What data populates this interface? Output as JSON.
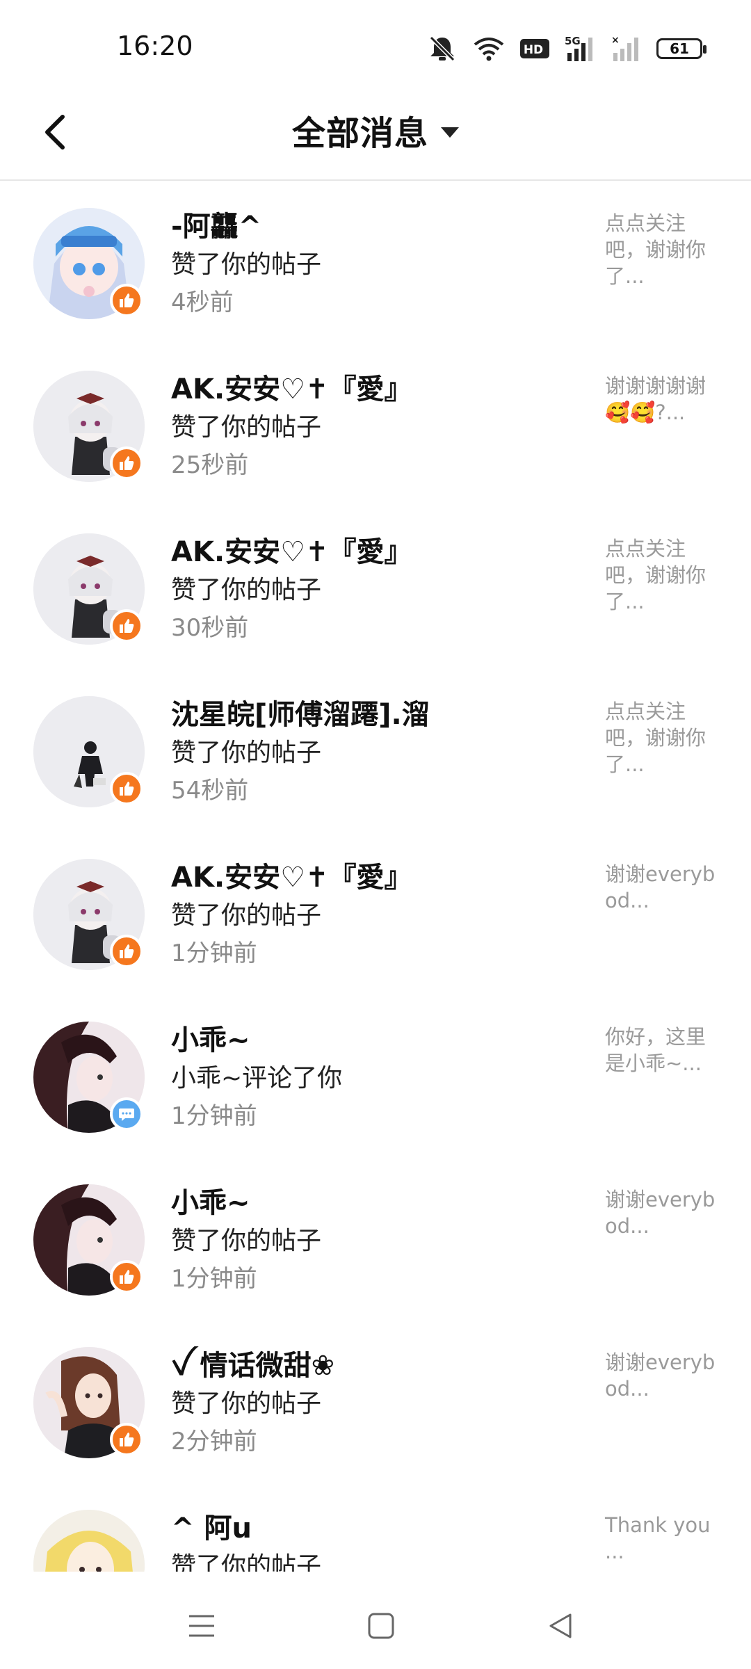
{
  "status_bar": {
    "time": "16:20",
    "icons": [
      "mute-icon",
      "wifi-icon",
      "hd-icon",
      "5g-signal-icon",
      "signal-icon-2"
    ],
    "hd_label": "HD",
    "network_label": "5G",
    "battery": "61"
  },
  "header": {
    "back_icon": "chevron-left-icon",
    "title": "全部消息",
    "dropdown_icon": "caret-down-icon"
  },
  "colors": {
    "like_badge": "#f5771e",
    "comment_badge": "#5aa9f0",
    "secondary_text": "#8a8a8a",
    "preview_text": "#9a9a9a"
  },
  "notifications": [
    {
      "name": "-阿龘^",
      "action": "赞了你的帖子",
      "time": "4秒前",
      "preview": "点点关注吧，谢谢你了...",
      "badge": "like",
      "avatar": "anime-girl-blue"
    },
    {
      "name": "AK.安安♡✝『愛』",
      "action": "赞了你的帖子",
      "time": "25秒前",
      "preview": "谢谢谢谢谢🥰🥰?...",
      "badge": "like",
      "avatar": "anime-girl-white"
    },
    {
      "name": "AK.安安♡✝『愛』",
      "action": "赞了你的帖子",
      "time": "30秒前",
      "preview": "点点关注吧，谢谢你了...",
      "badge": "like",
      "avatar": "anime-girl-white"
    },
    {
      "name": "沈星皖[师傅溜蹮].溜",
      "action": "赞了你的帖子",
      "time": "54秒前",
      "preview": "点点关注吧，谢谢你了...",
      "badge": "like",
      "avatar": "small-figure"
    },
    {
      "name": "AK.安安♡✝『愛』",
      "action": "赞了你的帖子",
      "time": "1分钟前",
      "preview": "谢谢everybod...",
      "badge": "like",
      "avatar": "anime-girl-white"
    },
    {
      "name": "小乖~",
      "action": "小乖~评论了你",
      "time": "1分钟前",
      "preview": "你好，这里是小乖~...",
      "badge": "comment",
      "avatar": "anime-boy-dark"
    },
    {
      "name": "小乖~",
      "action": "赞了你的帖子",
      "time": "1分钟前",
      "preview": "谢谢everybod...",
      "badge": "like",
      "avatar": "anime-boy-dark"
    },
    {
      "name": "ꪜ 情话微甜❀",
      "action": "赞了你的帖子",
      "time": "2分钟前",
      "preview": "谢谢everybod...",
      "badge": "like",
      "avatar": "anime-girl-brown"
    },
    {
      "name": "^ 阿u",
      "action": "赞了你的帖子",
      "time": "",
      "preview": "Thank you ...",
      "badge": "none",
      "avatar": "anime-girl-blonde"
    }
  ],
  "nav_bar": {
    "icons": [
      "menu-icon",
      "home-icon",
      "back-triangle-icon"
    ]
  }
}
